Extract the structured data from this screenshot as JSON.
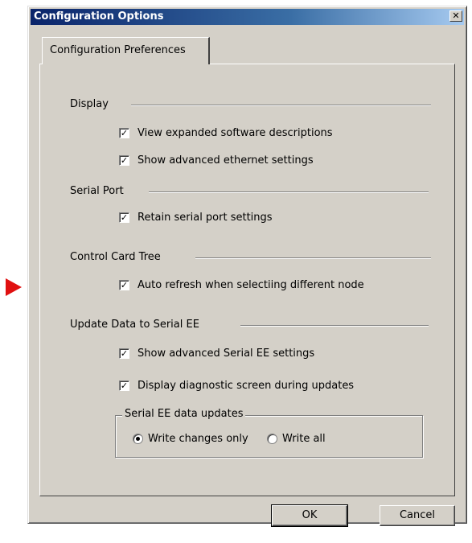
{
  "window": {
    "title": "Configuration Options",
    "close_glyph": "✕"
  },
  "tab": {
    "label": "Configuration Preferences"
  },
  "sections": {
    "display": {
      "label": "Display",
      "options": [
        {
          "label": "View expanded software descriptions",
          "checked": true
        },
        {
          "label": "Show advanced ethernet settings",
          "checked": true
        }
      ]
    },
    "serial_port": {
      "label": "Serial Port",
      "options": [
        {
          "label": "Retain serial port settings",
          "checked": true
        }
      ]
    },
    "control_card_tree": {
      "label": "Control Card Tree",
      "options": [
        {
          "label": "Auto refresh when selectiing different node",
          "checked": true
        }
      ]
    },
    "update_serial_ee": {
      "label": "Update Data to Serial EE",
      "options": [
        {
          "label": "Show advanced Serial EE settings",
          "checked": true
        },
        {
          "label": "Display diagnostic screen during updates",
          "checked": true
        }
      ]
    }
  },
  "serial_ee_group": {
    "title": "Serial EE data updates",
    "radios": [
      {
        "label": "Write changes only",
        "selected": true
      },
      {
        "label": "Write all",
        "selected": false
      }
    ]
  },
  "buttons": {
    "ok": "OK",
    "cancel": "Cancel"
  },
  "check_glyph": "✓",
  "colors": {
    "titlebar_start": "#0a246a",
    "titlebar_end": "#a6caf0",
    "dialog_bg": "#d4d0c8",
    "marker": "#e01010"
  },
  "icons": {
    "marker": "red-triangle-pointer-icon",
    "close": "close-icon"
  }
}
